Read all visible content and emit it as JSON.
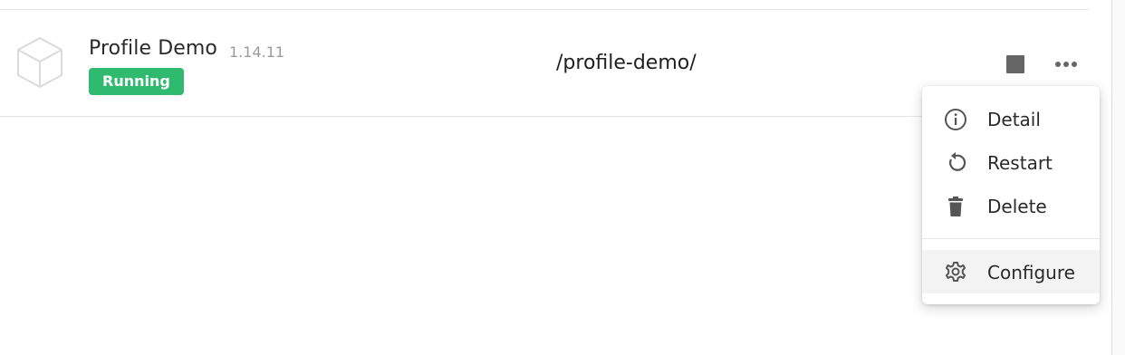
{
  "app": {
    "name": "Profile Demo",
    "version": "1.14.11",
    "status": "Running",
    "status_color": "#2fba6f",
    "path": "/profile-demo/",
    "icon": "cube-icon"
  },
  "actions": {
    "stop_icon": "stop-icon",
    "more_icon": "more-horizontal-icon"
  },
  "menu": {
    "items": [
      {
        "label": "Detail",
        "icon": "info-icon"
      },
      {
        "label": "Restart",
        "icon": "restart-icon"
      },
      {
        "label": "Delete",
        "icon": "trash-icon"
      },
      {
        "label": "Configure",
        "icon": "gear-icon"
      }
    ]
  }
}
